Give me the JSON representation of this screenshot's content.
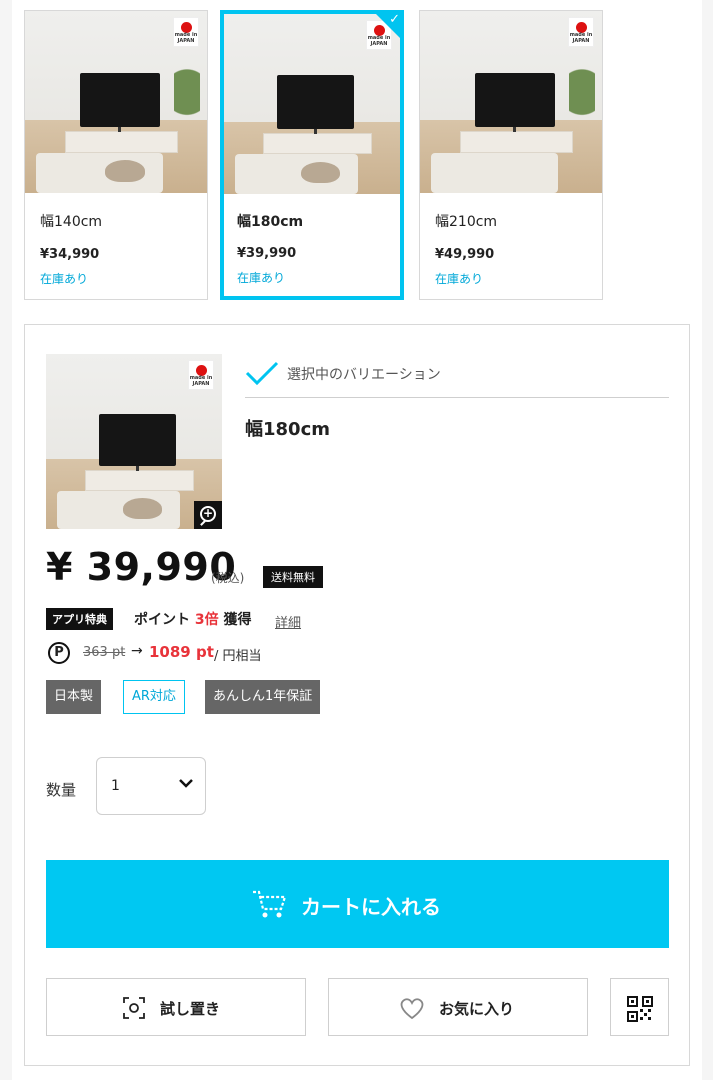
{
  "variations": [
    {
      "size": "幅140cm",
      "price": "¥34,990",
      "stock": "在庫あり",
      "selected": false
    },
    {
      "size": "幅180cm",
      "price": "¥39,990",
      "stock": "在庫あり",
      "selected": true
    },
    {
      "size": "幅210cm",
      "price": "¥49,990",
      "stock": "在庫あり",
      "selected": false
    }
  ],
  "flag_text": "made in JAPAN",
  "selected": {
    "label": "選択中のバリエーション",
    "size": "幅180cm",
    "price": "¥ 39,990",
    "tax": "(税込)",
    "free_shipping": "送料無料"
  },
  "points": {
    "app_badge": "アプリ特典",
    "point_prefix": "ポイント ",
    "multiplier": "3倍",
    "point_suffix": " 獲得",
    "detail_link": "詳細",
    "icon": "P",
    "old": "363 pt",
    "arrow": "→",
    "new": "1089 pt",
    "suffix": "/ 円相当"
  },
  "tags": [
    "日本製",
    "AR対応",
    "あんしん1年保証"
  ],
  "quantity": {
    "label": "数量",
    "value": "1"
  },
  "buttons": {
    "cart": "カートに入れる",
    "try_place": "試し置き",
    "favorite": "お気に入り"
  },
  "colors": {
    "accent": "#00c8f2",
    "point_red": "#e8333a",
    "tag_gray": "#666666"
  }
}
